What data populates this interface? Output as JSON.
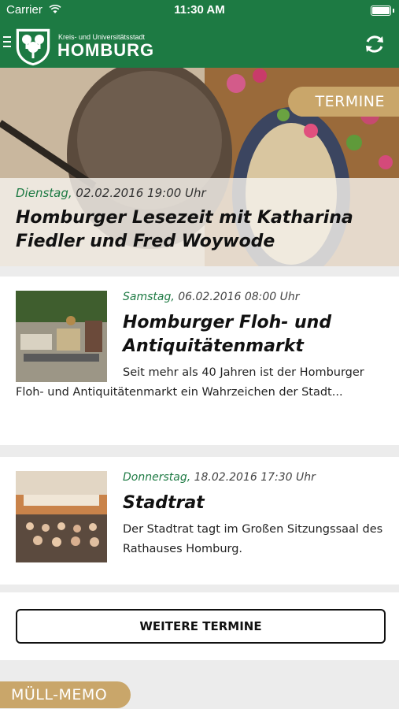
{
  "status_bar": {
    "carrier": "Carrier",
    "time": "11:30 AM",
    "battery_level": 1.0
  },
  "header": {
    "subtitle": "Kreis- und Universitätsstadt",
    "title": "HOMBURG"
  },
  "colors": {
    "brand_green": "#1d7a43",
    "accent_gold": "#c9a66a"
  },
  "icons": {
    "menu": "hamburger-menu-icon",
    "refresh": "refresh-icon",
    "crest": "homburg-crest-logo"
  },
  "hero": {
    "badge": "TERMINE",
    "weekday": "Dienstag,",
    "datetime": " 02.02.2016 19:00 Uhr",
    "title": "Homburger Lesezeit mit Katharina Fiedler und Fred Woywode"
  },
  "events": [
    {
      "weekday": "Samstag,",
      "datetime": " 06.02.2016 08:00 Uhr",
      "title": "Homburger Floh- und Antiquitätenmarkt",
      "text": "Seit mehr als 40 Jahren ist der Homburger Floh- und Antiquitätenmarkt ein Wahrzeichen der Stadt..."
    },
    {
      "weekday": "Donnerstag,",
      "datetime": " 18.02.2016 17:30 Uhr",
      "title": "Stadtrat",
      "text": "Der Stadtrat tagt im Großen Sitzungssaal des Rathauses Homburg."
    }
  ],
  "more_button": "WEITERE TERMINE",
  "muell_badge": "MÜLL-MEMO"
}
